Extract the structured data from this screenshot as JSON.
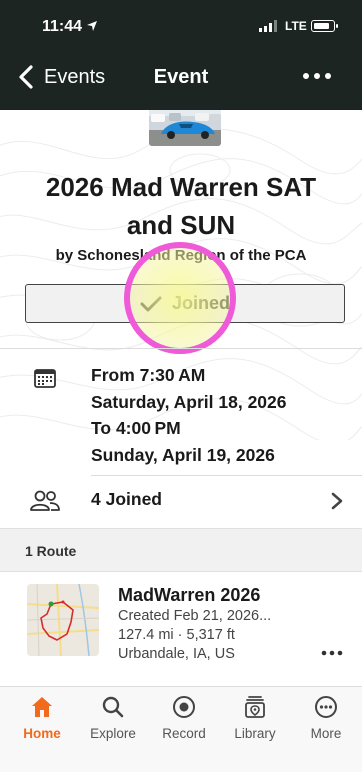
{
  "status_bar": {
    "time": "11:44",
    "network": "LTE"
  },
  "nav": {
    "back_label": "Events",
    "title": "Event"
  },
  "event": {
    "title_line1": "2026 Mad Warren SAT",
    "title_line2": "and SUN",
    "byline": "by Schonesland Region of the PCA",
    "joined_label": "Joined",
    "time_lines": [
      "From 7:30 AM",
      "Saturday, April 18, 2026",
      "To 4:00 PM",
      "Sunday, April 19, 2026"
    ],
    "attendees_label": "4 Joined"
  },
  "routes": {
    "header": "1 Route",
    "items": [
      {
        "name": "MadWarren 2026",
        "created": "Created Feb 21, 2026...",
        "stats": "127.4 mi · 5,317 ft",
        "location": "Urbandale, IA, US"
      }
    ]
  },
  "tabs": [
    {
      "label": "Home",
      "icon": "home-icon",
      "active": true
    },
    {
      "label": "Explore",
      "icon": "search-icon",
      "active": false
    },
    {
      "label": "Record",
      "icon": "record-icon",
      "active": false
    },
    {
      "label": "Library",
      "icon": "library-icon",
      "active": false
    },
    {
      "label": "More",
      "icon": "more-icon",
      "active": false
    }
  ],
  "colors": {
    "accent": "#f26a1b",
    "highlight_ring": "#ee5ad8",
    "topbar": "#1c2522"
  }
}
